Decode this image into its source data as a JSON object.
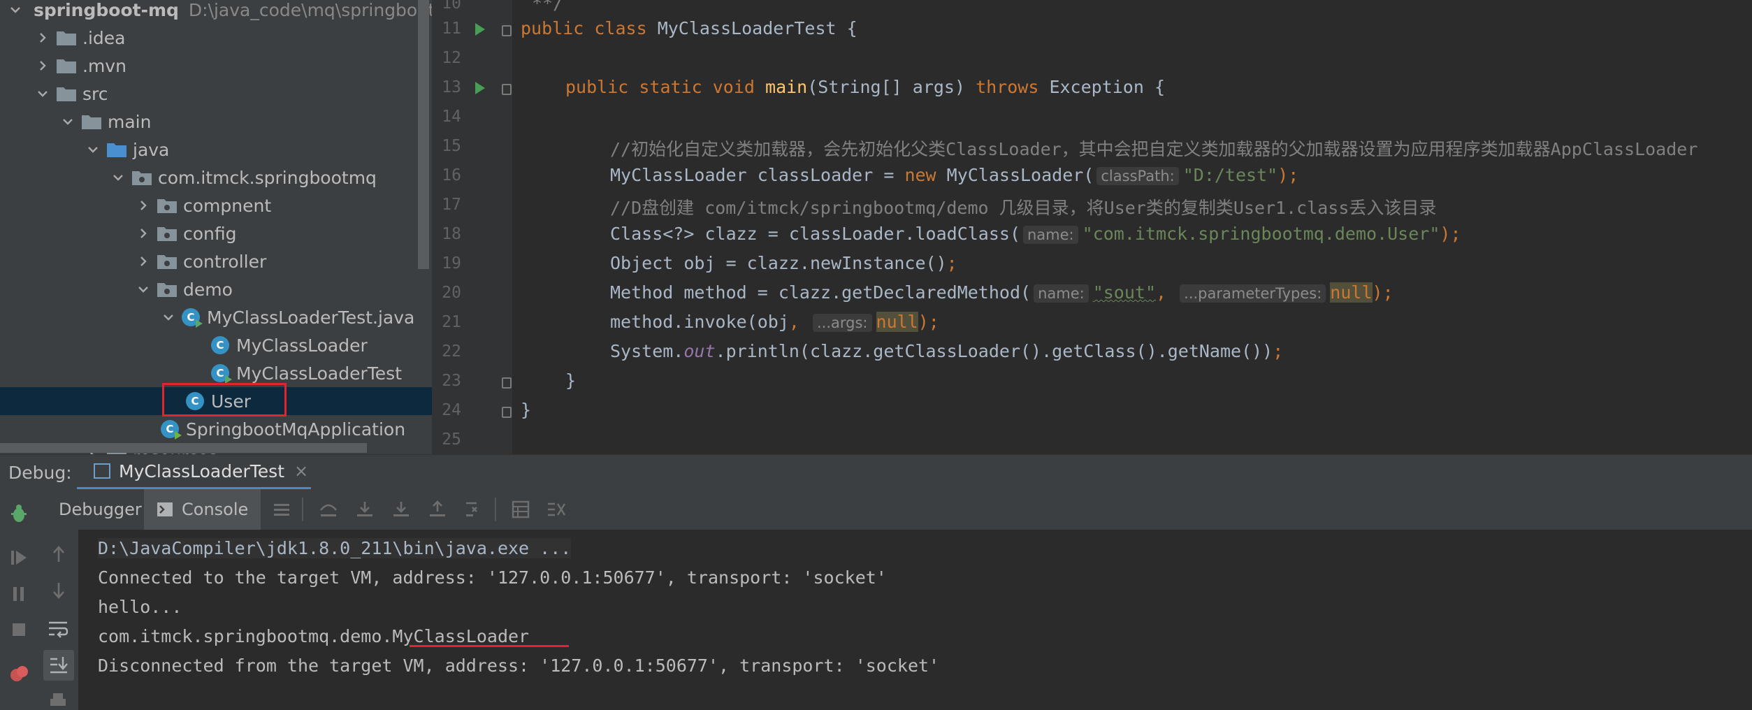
{
  "project_tree": {
    "root_name": "springboot-mq",
    "root_path": "D:\\java_code\\mq\\springboot-",
    "items": [
      {
        "label": ".idea",
        "level": 1,
        "type": "folder",
        "expanded": false
      },
      {
        "label": ".mvn",
        "level": 1,
        "type": "folder",
        "expanded": false
      },
      {
        "label": "src",
        "level": 1,
        "type": "folder",
        "expanded": true
      },
      {
        "label": "main",
        "level": 2,
        "type": "folder",
        "expanded": true
      },
      {
        "label": "java",
        "level": 3,
        "type": "folder",
        "expanded": true
      },
      {
        "label": "com.itmck.springbootmq",
        "level": 4,
        "type": "package",
        "expanded": true
      },
      {
        "label": "compnent",
        "level": 5,
        "type": "package",
        "expanded": false
      },
      {
        "label": "config",
        "level": 5,
        "type": "package",
        "expanded": false
      },
      {
        "label": "controller",
        "level": 5,
        "type": "package",
        "expanded": false
      },
      {
        "label": "demo",
        "level": 5,
        "type": "package",
        "expanded": true
      },
      {
        "label": "MyClassLoaderTest.java",
        "level": 6,
        "type": "java-file",
        "expanded": true
      },
      {
        "label": "MyClassLoader",
        "level": 7,
        "type": "class"
      },
      {
        "label": "MyClassLoaderTest",
        "level": 7,
        "type": "class-runnable"
      },
      {
        "label": "User",
        "level": 6,
        "type": "class",
        "selected": true
      },
      {
        "label": "SpringbootMqApplication",
        "level": 5,
        "type": "spring-class"
      },
      {
        "label": "resources",
        "level": 3,
        "type": "folder"
      }
    ]
  },
  "editor": {
    "line_numbers": [
      "10",
      "11",
      "12",
      "13",
      "14",
      "15",
      "16",
      "17",
      "18",
      "19",
      "20",
      "21",
      "22",
      "23",
      "24",
      "25"
    ],
    "line10": "**/",
    "line11": {
      "k1": "public",
      "k2": "class",
      "name": "MyClassLoaderTest",
      "brace": "{"
    },
    "line13": {
      "k1": "public",
      "k2": "static",
      "k3": "void",
      "fn": "main",
      "params": "(String[] args) ",
      "k4": "throws",
      "rest": " Exception {"
    },
    "line15": "//初始化自定义类加载器，会先初始化父类ClassLoader，其中会把自定义类加载器的父加载器设置为应用程序类加载器AppClassLoader",
    "line16": {
      "a": "MyClassLoader classLoader = ",
      "k": "new",
      "b": " MyClassLoader(",
      "hint": "classPath:",
      "s": "\"D:/test\"",
      "c": ");"
    },
    "line17": "//D盘创建 com/itmck/springbootmq/demo 几级目录，将User类的复制类User1.class丢入该目录",
    "line18": {
      "a": "Class<?> clazz = classLoader.loadClass(",
      "hint": "name:",
      "s": "\"com.itmck.springbootmq.demo.User\"",
      "c": ");"
    },
    "line19": {
      "a": "Object obj = clazz.newInstance()",
      "c": ";"
    },
    "line20": {
      "a": "Method method = clazz.getDeclaredMethod(",
      "hint1": "name:",
      "s": "\"sout\"",
      "comma": ",",
      "hint2": "...parameterTypes:",
      "n": "null",
      "c": ");"
    },
    "line21": {
      "a": "method.invoke(obj",
      "comma": ",",
      "hint": "...args:",
      "n": "null",
      "c": ");"
    },
    "line22": {
      "a": "System.",
      "out": "out",
      "b": ".println(clazz.getClassLoader().getClass().getName())",
      "c": ";"
    },
    "line23": "}",
    "line24": "}"
  },
  "debug": {
    "label": "Debug:",
    "tab_name": "MyClassLoaderTest",
    "tab_close": "×",
    "subtabs": {
      "debugger": "Debugger",
      "console": "Console"
    },
    "console_lines": [
      "D:\\JavaCompiler\\jdk1.8.0_211\\bin\\java.exe ...",
      "Connected to the target VM, address: '127.0.0.1:50677', transport: 'socket'",
      "hello...",
      "com.itmck.springbootmq.demo.MyClassLoader",
      "Disconnected from the target VM, address: '127.0.0.1:50677', transport: 'socket'"
    ]
  },
  "colors": {
    "accent_tab": "#4a88c7",
    "highlight_red": "#e0252f",
    "keyword": "#cc7832",
    "string": "#6a8759",
    "function": "#ffc66d"
  }
}
